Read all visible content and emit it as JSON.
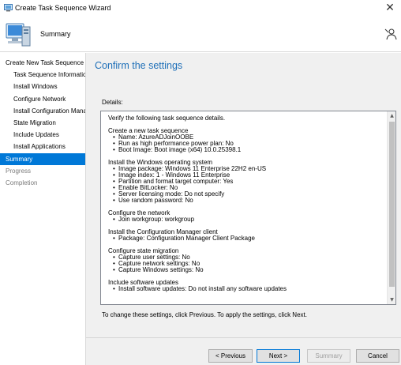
{
  "window": {
    "title": "Create Task Sequence Wizard",
    "close_glyph": "✕"
  },
  "header": {
    "page_heading": "Summary"
  },
  "sidebar": {
    "items": [
      {
        "label": "Create New Task Sequence",
        "state": "normal"
      },
      {
        "label": "Task Sequence Information",
        "state": "normal"
      },
      {
        "label": "Install Windows",
        "state": "normal"
      },
      {
        "label": "Configure Network",
        "state": "normal"
      },
      {
        "label": "Install Configuration Manager",
        "state": "normal"
      },
      {
        "label": "State Migration",
        "state": "normal"
      },
      {
        "label": "Include Updates",
        "state": "normal"
      },
      {
        "label": "Install Applications",
        "state": "normal"
      },
      {
        "label": "Summary",
        "state": "active"
      },
      {
        "label": "Progress",
        "state": "disabled"
      },
      {
        "label": "Completion",
        "state": "disabled"
      }
    ]
  },
  "main": {
    "title": "Confirm the settings",
    "details_label": "Details:",
    "details_lines": [
      {
        "text": "Verify the following task sequence details.",
        "bullet": false
      },
      {
        "text": "",
        "bullet": false
      },
      {
        "text": "Create a new task sequence",
        "bullet": false
      },
      {
        "text": "Name: AzureADJoinOOBE",
        "bullet": true
      },
      {
        "text": "Run as high performance power plan: No",
        "bullet": true
      },
      {
        "text": "Boot Image: Boot image (x64) 10.0.25398.1",
        "bullet": true
      },
      {
        "text": "",
        "bullet": false
      },
      {
        "text": "Install the Windows operating system",
        "bullet": false
      },
      {
        "text": "Image package: Windows 11 Enterprise 22H2 en-US",
        "bullet": true
      },
      {
        "text": "Image index: 1 - Windows 11 Enterprise",
        "bullet": true
      },
      {
        "text": "Partition and format target computer: Yes",
        "bullet": true
      },
      {
        "text": "Enable BitLocker: No",
        "bullet": true
      },
      {
        "text": "Server licensing mode: Do not specify",
        "bullet": true
      },
      {
        "text": "Use random password: No",
        "bullet": true
      },
      {
        "text": "",
        "bullet": false
      },
      {
        "text": "Configure the network",
        "bullet": false
      },
      {
        "text": "Join workgroup: workgroup",
        "bullet": true
      },
      {
        "text": "",
        "bullet": false
      },
      {
        "text": "Install the Configuration Manager client",
        "bullet": false
      },
      {
        "text": "Package: Configuration Manager Client Package",
        "bullet": true
      },
      {
        "text": "",
        "bullet": false
      },
      {
        "text": "Configure state migration",
        "bullet": false
      },
      {
        "text": "Capture user settings: No",
        "bullet": true
      },
      {
        "text": "Capture network settings: No",
        "bullet": true
      },
      {
        "text": "Capture Windows settings: No",
        "bullet": true
      },
      {
        "text": "",
        "bullet": false
      },
      {
        "text": "Include software updates",
        "bullet": false
      },
      {
        "text": "Install software updates: Do not install any software updates",
        "bullet": true
      }
    ],
    "instructions": "To change these settings, click Previous. To apply the settings, click Next."
  },
  "buttons": {
    "previous": "< Previous",
    "next": "Next >",
    "summary": "Summary",
    "cancel": "Cancel"
  },
  "scrollbar": {
    "up_glyph": "▲",
    "down_glyph": "▼"
  }
}
